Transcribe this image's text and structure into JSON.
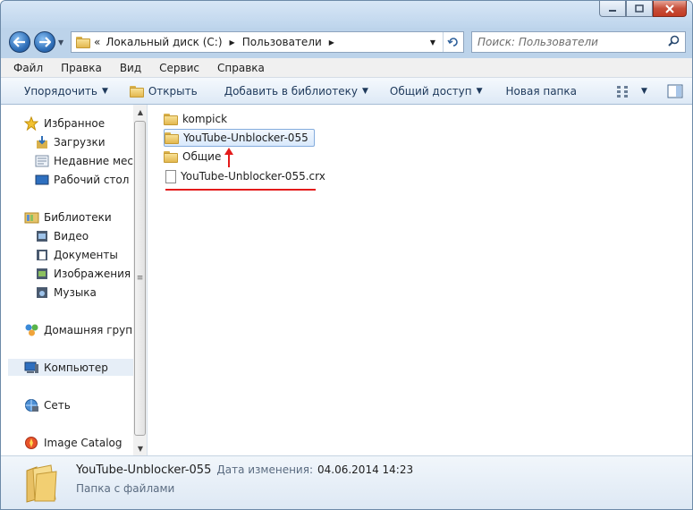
{
  "address": {
    "chevron": "«",
    "crumbs": [
      "Локальный диск (C:)",
      "Пользователи"
    ]
  },
  "search": {
    "placeholder": "Поиск: Пользователи"
  },
  "menu": [
    "Файл",
    "Правка",
    "Вид",
    "Сервис",
    "Справка"
  ],
  "toolbar": {
    "organize": "Упорядочить",
    "open": "Открыть",
    "library": "Добавить в библиотеку",
    "share": "Общий доступ",
    "new_folder": "Новая папка"
  },
  "nav": {
    "favorites": "Избранное",
    "downloads": "Загрузки",
    "recent": "Недавние места",
    "desktop": "Рабочий стол",
    "libraries": "Библиотеки",
    "video": "Видео",
    "documents": "Документы",
    "images": "Изображения",
    "music": "Музыка",
    "homegroup": "Домашняя группа",
    "computer": "Компьютер",
    "network": "Сеть",
    "image_catalog": "Image Catalog"
  },
  "files": [
    {
      "name": "kompick",
      "type": "folder-locked"
    },
    {
      "name": "YouTube-Unblocker-055",
      "type": "folder",
      "selected": true
    },
    {
      "name": "Общие",
      "type": "folder"
    },
    {
      "name": "YouTube-Unblocker-055.crx",
      "type": "file"
    }
  ],
  "status": {
    "name": "YouTube-Unblocker-055",
    "modified_label": "Дата изменения:",
    "modified_value": "04.06.2014 14:23",
    "type": "Папка с файлами"
  },
  "colors": {
    "annotation": "#e41b1b",
    "selection": "#d9e9fc",
    "accent": "#1e395b"
  }
}
